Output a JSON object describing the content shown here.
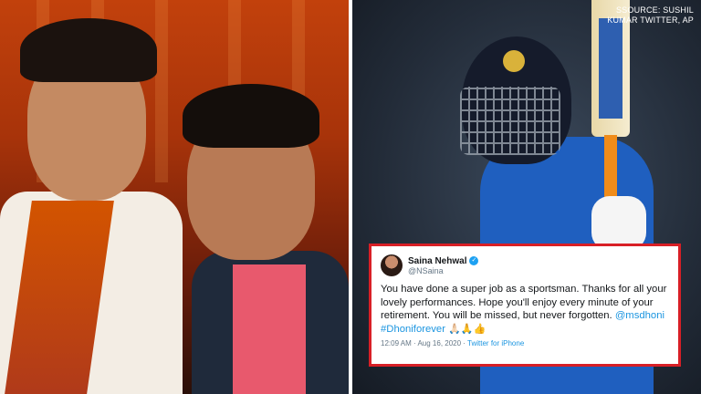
{
  "source_credit": {
    "line1": "SSOURCE: SUSHIL",
    "line2": "KUMAR TWITTER, AP"
  },
  "tweet": {
    "author_name": "Saina Nehwal",
    "author_handle": "@NSaina",
    "verified_mark": "✓",
    "text": "You have done a super job as a sportsman. Thanks for all your lovely performances. Hope you'll enjoy every minute of your retirement. You will be missed, but never forgotten.",
    "mention": "@msdhoni",
    "hashtag": "#Dhoniforever",
    "emojis": "🙏🏻🙏👍",
    "time": "12:09 AM · Aug 16, 2020 · ",
    "app": "Twitter for iPhone"
  },
  "colors": {
    "card_border": "#d81f26",
    "link": "#1b95e0",
    "verified": "#1da1f2"
  }
}
